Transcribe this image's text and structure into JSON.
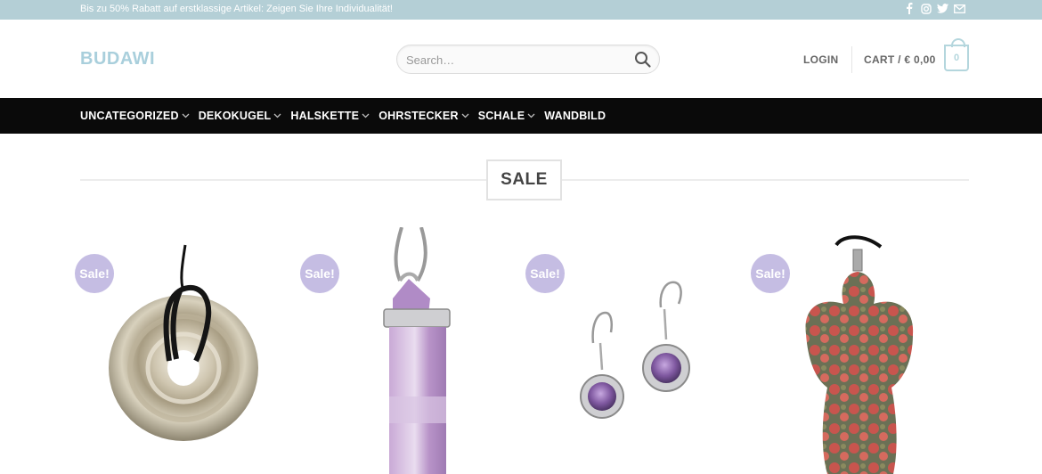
{
  "topbar": {
    "promo": "Bis zu 50% Rabatt auf erstklassige Artikel: Zeigen Sie Ihre Individualität!",
    "socials": [
      "facebook-icon",
      "instagram-icon",
      "twitter-icon",
      "email-icon"
    ]
  },
  "header": {
    "logo": "BUDAWI",
    "search_placeholder": "Search…",
    "login": "LOGIN",
    "cart_label": "CART / € 0,00",
    "cart_count": "0"
  },
  "nav": {
    "items": [
      {
        "label": "UNCATEGORIZED",
        "has_dropdown": true
      },
      {
        "label": "DEKOKUGEL",
        "has_dropdown": true
      },
      {
        "label": "HALSKETTE",
        "has_dropdown": true
      },
      {
        "label": "OHRSTECKER",
        "has_dropdown": true
      },
      {
        "label": "SCHALE",
        "has_dropdown": true
      },
      {
        "label": "WANDBILD",
        "has_dropdown": false
      }
    ]
  },
  "section": {
    "title": "SALE"
  },
  "products": [
    {
      "badge": "Sale!",
      "image": "agate-donut-pendant"
    },
    {
      "badge": "Sale!",
      "image": "amethyst-point-pendant"
    },
    {
      "badge": "Sale!",
      "image": "amethyst-earrings"
    },
    {
      "badge": "Sale!",
      "image": "unakite-angel-pendant"
    }
  ],
  "colors": {
    "topbar_bg": "#b4cfd6",
    "logo": "#a9cfdc",
    "nav_bg": "#0a0a0a",
    "sale_badge": "#c5bde3"
  }
}
